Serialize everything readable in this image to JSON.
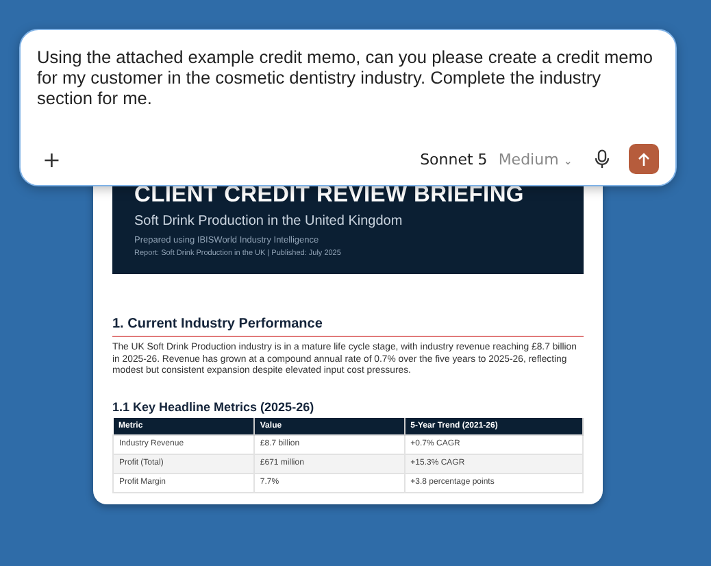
{
  "prompt": {
    "text": "Using the attached example credit memo, can you please create a credit memo for my customer in the cosmetic dentistry industry. Complete the industry section for me.",
    "add_button": "+",
    "model": "Sonnet 5",
    "effort": "Medium",
    "effort_caret": "⌄"
  },
  "document": {
    "title": "CLIENT CREDIT REVIEW BRIEFING",
    "subtitle": "Soft Drink Production in the United Kingdom",
    "prepared": "Prepared using IBISWorld Industry Intelligence",
    "report": "Report: Soft Drink Production in the UK  |  Published: July 2025",
    "section_heading": "1. Current Industry Performance",
    "paragraph": "The UK Soft Drink Production industry is in a mature life cycle stage, with industry revenue reaching £8.7 billion in 2025-26. Revenue has grown at a compound annual rate of 0.7% over the five years to 2025-26, reflecting modest but consistent expansion despite elevated input cost pressures.",
    "subheading": "1.1  Key Headline Metrics (2025-26)",
    "table": {
      "columns": [
        "Metric",
        "Value",
        "5-Year Trend (2021-26)"
      ],
      "rows": [
        [
          "Industry Revenue",
          "£8.7 billion",
          "+0.7% CAGR"
        ],
        [
          "Profit (Total)",
          "£671 million",
          "+15.3% CAGR"
        ],
        [
          "Profit Margin",
          "7.7%",
          "+3.8 percentage points"
        ]
      ]
    }
  }
}
